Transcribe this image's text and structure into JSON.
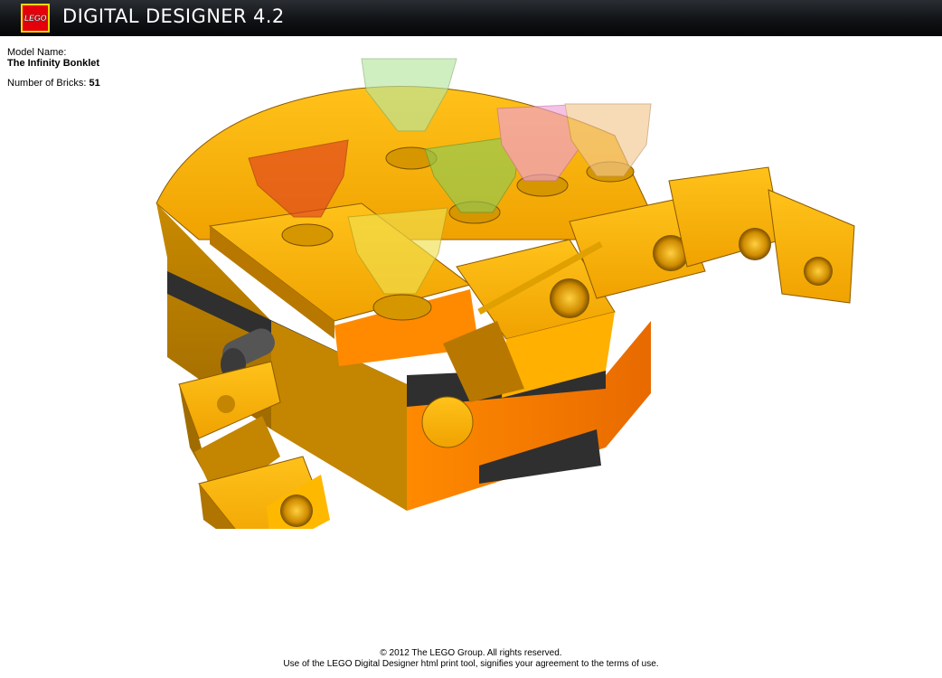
{
  "header": {
    "logo_text": "LEGO",
    "title": "DIGITAL DESIGNER 4.2"
  },
  "model_info": {
    "name_label": "Model Name:",
    "name": "The Infinity Bonklet",
    "bricks_label": "Number of Bricks:",
    "bricks_count": "51"
  },
  "render": {
    "icon": "lego-model-render",
    "gem_colors": [
      "#e0401e",
      "#b8e8a0",
      "#90cc55",
      "#f0a0d8",
      "#f2c890",
      "#f0e050"
    ],
    "body_color": "#f5a800",
    "trim_color": "#2f2f2f"
  },
  "footer": {
    "copyright": "© 2012 The LEGO Group. All rights reserved.",
    "terms": "Use of the LEGO Digital Designer html print tool, signifies your agreement to the terms of use."
  }
}
